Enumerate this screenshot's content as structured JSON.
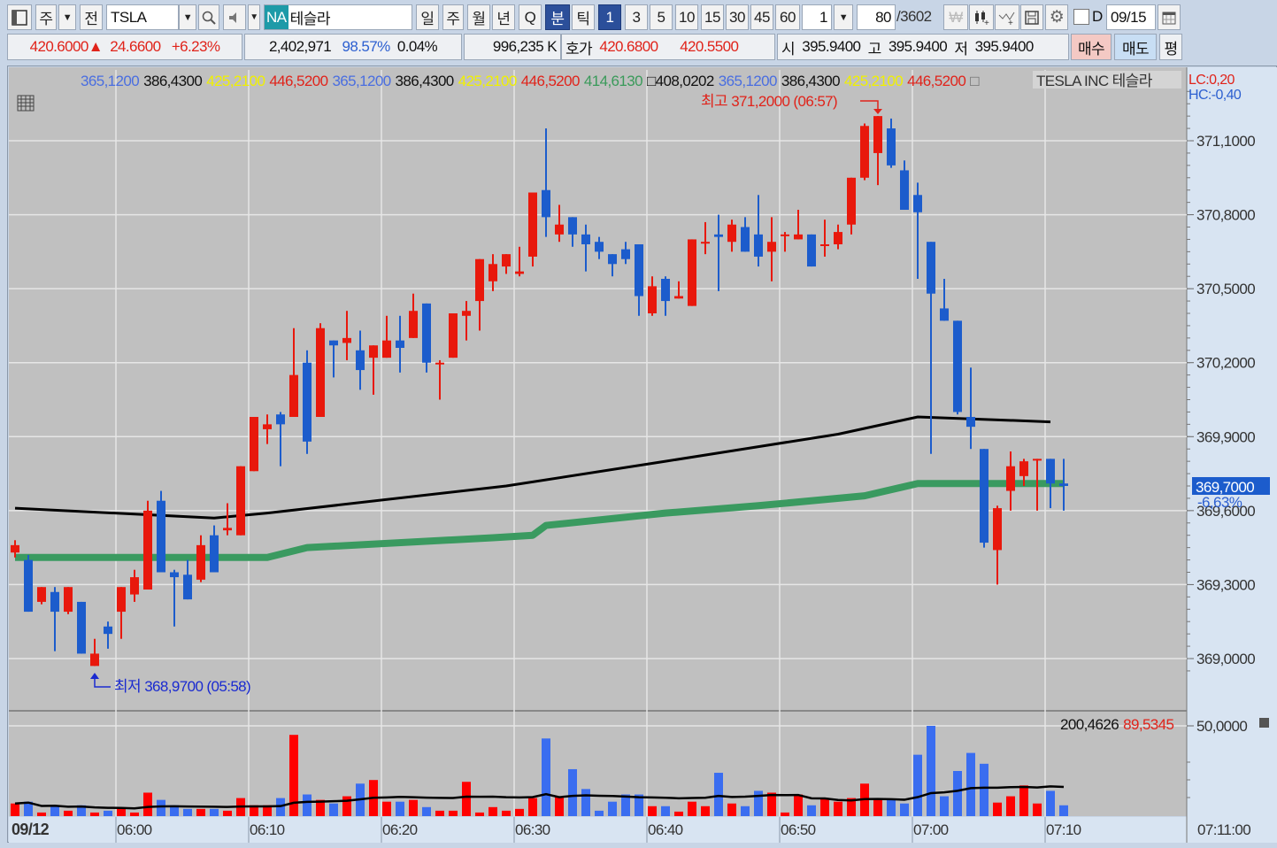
{
  "toolbar": {
    "market": "주",
    "all": "전",
    "symbol": "TSLA",
    "na": "NA",
    "name": "테슬라",
    "periods": [
      "일",
      "주",
      "월",
      "년",
      "Q"
    ],
    "units": [
      "분",
      "틱"
    ],
    "intervals": [
      "1",
      "3",
      "5",
      "10",
      "15",
      "30",
      "45",
      "60"
    ],
    "interval_count": "1",
    "bar_count": "80",
    "total": "/3602",
    "d_label": "D",
    "date": "09/15"
  },
  "quote": {
    "price": "420.6000",
    "arrow": "▲",
    "change": "24.6600",
    "pct": "+6.23%",
    "volume": "2,402,971",
    "ratio": "98.57%",
    "turnover": "0.04%",
    "amount": "996,235 K",
    "hoga_label": "호가",
    "ask": "420.6800",
    "bid": "420.5500",
    "open_label": "시",
    "open": "395.9400",
    "high_label": "고",
    "high": "395.9400",
    "low_label": "저",
    "low": "395.9400",
    "buy": "매수",
    "sell": "매도",
    "avg": "평"
  },
  "legend": [
    {
      "text": "365,1200",
      "color": "#4a6ee0"
    },
    {
      "text": "386,4300",
      "color": "#111111"
    },
    {
      "text": "425,2100",
      "color": "#f0f000"
    },
    {
      "text": "446,5200",
      "color": "#e0231a"
    },
    {
      "text": "365,1200",
      "color": "#4a6ee0"
    },
    {
      "text": "386,4300",
      "color": "#111111"
    },
    {
      "text": "425,2100",
      "color": "#f0f000"
    },
    {
      "text": "446,5200",
      "color": "#e0231a"
    },
    {
      "text": "414,6130",
      "color": "#3a9a5a"
    },
    {
      "text": "□408,0202",
      "color": "#111111"
    },
    {
      "text": "365,1200",
      "color": "#4a6ee0"
    },
    {
      "text": "386,4300",
      "color": "#111111"
    },
    {
      "text": "425,2100",
      "color": "#f0f000"
    },
    {
      "text": "446,5200",
      "color": "#e0231a"
    },
    {
      "text": "□",
      "color": "#666666"
    }
  ],
  "instrument": "TESLA INC  테슬라",
  "lc": "LC:0,20",
  "hc": "HC:-0,40",
  "colors": {
    "up": "#e8180c",
    "down": "#1c5ccc",
    "vol_up": "#ff0000",
    "vol_down": "#3a6df0",
    "ma_long": "#000000",
    "ma_short": "#3a9a60",
    "bg": "#c0c0c0",
    "axis_bg": "#d8e4f2"
  },
  "chart_data": {
    "type": "candlestick",
    "start_time": "05:52",
    "date_label": "09/12",
    "time_labels": [
      "06:00",
      "06:10",
      "06:20",
      "06:30",
      "06:40",
      "06:50",
      "07:00",
      "07:10"
    ],
    "end_time_label": "07:11:00",
    "price_ticks": [
      371.1,
      370.8,
      370.5,
      370.2,
      369.9,
      369.6,
      369.3,
      369.0
    ],
    "price_range": [
      368.87,
      371.4
    ],
    "high_note": "최고 371,2000 (06:57)",
    "high_index": 65,
    "low_note": "최저 368,9700 (05:58)",
    "low_index": 6,
    "last_price": "369,7000",
    "last_pct": "-6,63%",
    "last_value": 369.7,
    "candles": [
      [
        369.43,
        369.48,
        369.41,
        369.46
      ],
      [
        369.4,
        369.42,
        369.19,
        369.19
      ],
      [
        369.23,
        369.29,
        369.22,
        369.29
      ],
      [
        369.27,
        369.29,
        369.03,
        369.19
      ],
      [
        369.19,
        369.29,
        369.18,
        369.29
      ],
      [
        369.23,
        369.23,
        369.02,
        369.02
      ],
      [
        368.97,
        369.08,
        368.97,
        369.02
      ],
      [
        369.13,
        369.15,
        369.04,
        369.1
      ],
      [
        369.19,
        369.29,
        369.08,
        369.29
      ],
      [
        369.26,
        369.36,
        369.23,
        369.33
      ],
      [
        369.28,
        369.64,
        369.28,
        369.6
      ],
      [
        369.64,
        369.68,
        369.35,
        369.35
      ],
      [
        369.35,
        369.36,
        369.13,
        369.33
      ],
      [
        369.34,
        369.4,
        369.24,
        369.24
      ],
      [
        369.32,
        369.5,
        369.31,
        369.46
      ],
      [
        369.5,
        369.54,
        369.35,
        369.35
      ],
      [
        369.52,
        369.63,
        369.5,
        369.53
      ],
      [
        369.5,
        369.78,
        369.5,
        369.78
      ],
      [
        369.76,
        369.98,
        369.76,
        369.98
      ],
      [
        369.93,
        369.99,
        369.87,
        369.95
      ],
      [
        369.99,
        370.0,
        369.78,
        369.95
      ],
      [
        369.98,
        370.34,
        369.98,
        370.15
      ],
      [
        370.2,
        370.25,
        369.83,
        369.88
      ],
      [
        369.98,
        370.36,
        369.98,
        370.34
      ],
      [
        370.29,
        370.29,
        370.14,
        370.27
      ],
      [
        370.28,
        370.41,
        370.21,
        370.3
      ],
      [
        370.25,
        370.33,
        370.09,
        370.17
      ],
      [
        370.22,
        370.27,
        370.07,
        370.27
      ],
      [
        370.22,
        370.39,
        370.22,
        370.29
      ],
      [
        370.29,
        370.39,
        370.16,
        370.26
      ],
      [
        370.3,
        370.48,
        370.3,
        370.41
      ],
      [
        370.44,
        370.44,
        370.16,
        370.2
      ],
      [
        370.2,
        370.21,
        370.05,
        370.2
      ],
      [
        370.22,
        370.4,
        370.22,
        370.4
      ],
      [
        370.39,
        370.45,
        370.29,
        370.41
      ],
      [
        370.45,
        370.62,
        370.33,
        370.62
      ],
      [
        370.53,
        370.64,
        370.49,
        370.6
      ],
      [
        370.59,
        370.64,
        370.56,
        370.64
      ],
      [
        370.56,
        370.67,
        370.55,
        370.57
      ],
      [
        370.63,
        370.89,
        370.59,
        370.89
      ],
      [
        370.9,
        371.15,
        370.71,
        370.79
      ],
      [
        370.72,
        370.84,
        370.69,
        370.76
      ],
      [
        370.79,
        370.79,
        370.67,
        370.72
      ],
      [
        370.72,
        370.76,
        370.57,
        370.68
      ],
      [
        370.69,
        370.71,
        370.62,
        370.65
      ],
      [
        370.64,
        370.64,
        370.55,
        370.6
      ],
      [
        370.66,
        370.69,
        370.6,
        370.62
      ],
      [
        370.68,
        370.68,
        370.39,
        370.47
      ],
      [
        370.4,
        370.55,
        370.39,
        370.51
      ],
      [
        370.54,
        370.55,
        370.39,
        370.45
      ],
      [
        370.46,
        370.53,
        370.46,
        370.47
      ],
      [
        370.43,
        370.7,
        370.43,
        370.7
      ],
      [
        370.69,
        370.77,
        370.64,
        370.69
      ],
      [
        370.72,
        370.8,
        370.49,
        370.71
      ],
      [
        370.69,
        370.78,
        370.65,
        370.76
      ],
      [
        370.75,
        370.79,
        370.65,
        370.65
      ],
      [
        370.72,
        370.88,
        370.59,
        370.63
      ],
      [
        370.65,
        370.79,
        370.53,
        370.69
      ],
      [
        370.72,
        370.73,
        370.65,
        370.72
      ],
      [
        370.7,
        370.82,
        370.7,
        370.72
      ],
      [
        370.72,
        370.72,
        370.59,
        370.59
      ],
      [
        370.68,
        370.78,
        370.63,
        370.68
      ],
      [
        370.68,
        370.76,
        370.66,
        370.73
      ],
      [
        370.76,
        370.95,
        370.72,
        370.95
      ],
      [
        370.95,
        371.17,
        370.94,
        371.16
      ],
      [
        371.05,
        371.2,
        370.92,
        371.2
      ],
      [
        371.15,
        371.19,
        370.99,
        371.0
      ],
      [
        370.98,
        371.02,
        370.82,
        370.82
      ],
      [
        370.88,
        370.93,
        370.54,
        370.81
      ],
      [
        370.69,
        370.69,
        369.83,
        370.48
      ],
      [
        370.42,
        370.54,
        370.37,
        370.37
      ],
      [
        370.37,
        370.37,
        369.99,
        370.0
      ],
      [
        369.98,
        370.18,
        369.85,
        369.94
      ],
      [
        369.85,
        369.85,
        369.45,
        369.47
      ],
      [
        369.44,
        369.62,
        369.3,
        369.61
      ],
      [
        369.68,
        369.84,
        369.6,
        369.78
      ],
      [
        369.74,
        369.81,
        369.7,
        369.8
      ],
      [
        369.81,
        369.81,
        369.6,
        369.81
      ],
      [
        369.81,
        369.81,
        369.61,
        369.71
      ],
      [
        369.71,
        369.81,
        369.6,
        369.7
      ]
    ],
    "ma_long": [
      [
        0,
        369.61
      ],
      [
        15,
        369.57
      ],
      [
        19,
        369.59
      ],
      [
        37,
        369.7
      ],
      [
        49,
        369.8
      ],
      [
        62,
        369.91
      ],
      [
        68,
        369.98
      ],
      [
        78,
        369.96
      ]
    ],
    "ma_short": [
      [
        0,
        369.41
      ],
      [
        19,
        369.41
      ],
      [
        22,
        369.45
      ],
      [
        36,
        369.49
      ],
      [
        39,
        369.5
      ],
      [
        40,
        369.54
      ],
      [
        49,
        369.59
      ],
      [
        56,
        369.62
      ],
      [
        64,
        369.66
      ],
      [
        68,
        369.71
      ],
      [
        79,
        369.71
      ]
    ],
    "volume": [
      7,
      8,
      2,
      6,
      3,
      6,
      2,
      3,
      4,
      2,
      13,
      9,
      6,
      4,
      4,
      4,
      3,
      10,
      6,
      6,
      10,
      45,
      12,
      9,
      7,
      11,
      18,
      20,
      8,
      8,
      9,
      5,
      3,
      3,
      19,
      2,
      5,
      3,
      4,
      10,
      43,
      11,
      26,
      15,
      3,
      8,
      12,
      12,
      5.5,
      5.5,
      2.5,
      8,
      5.5,
      24,
      7,
      5.5,
      14,
      13,
      2,
      12,
      6,
      10,
      8,
      10,
      18,
      9.5,
      9,
      7,
      34,
      50,
      11,
      25,
      35,
      29,
      7.5,
      11,
      17,
      7,
      14,
      6
    ],
    "volume_axis": "50,0000",
    "volume_max": 50,
    "volume_legend": [
      {
        "text": "200,4626",
        "color": "#111111"
      },
      {
        "text": "89,5345",
        "color": "#e0231a"
      }
    ]
  }
}
